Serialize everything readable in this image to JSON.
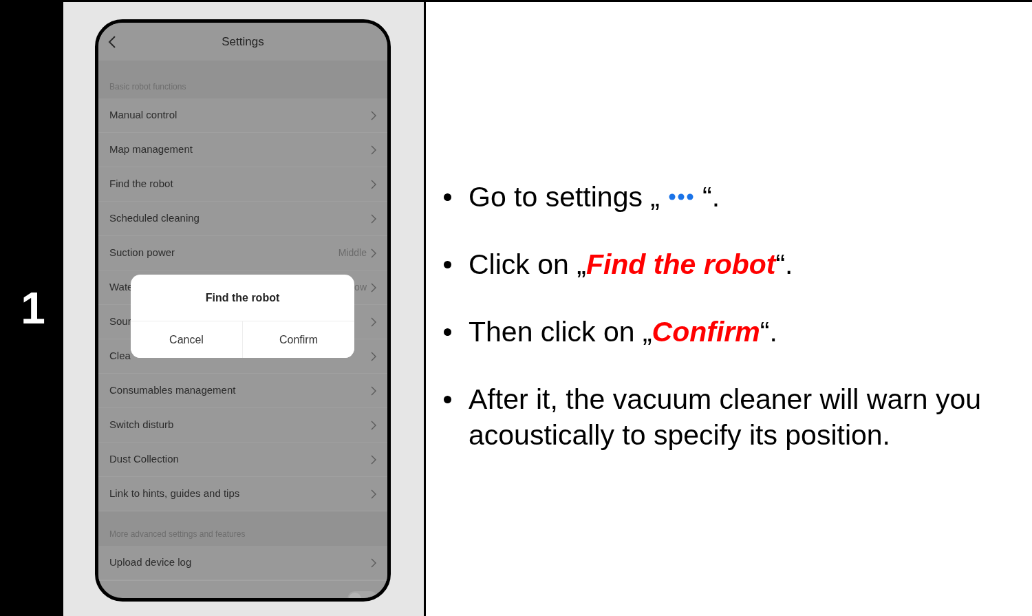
{
  "step": {
    "number": "1"
  },
  "phone": {
    "title": "Settings",
    "sections": [
      {
        "header": "Basic robot functions",
        "rows": [
          {
            "label": "Manual control"
          },
          {
            "label": "Map management"
          },
          {
            "label": "Find the robot"
          },
          {
            "label": "Scheduled cleaning"
          },
          {
            "label": "Suction power",
            "value": "Middle"
          },
          {
            "label": "Wate",
            "value": "ow"
          },
          {
            "label": "Sour"
          },
          {
            "label": "Clea"
          },
          {
            "label": "Consumables management"
          },
          {
            "label": "Switch disturb"
          },
          {
            "label": "Dust Collection"
          },
          {
            "label": "Link to hints, guides and tips"
          }
        ]
      },
      {
        "header": "More advanced settings and features",
        "rows": [
          {
            "label": "Upload device log"
          },
          {
            "kind": "toggle",
            "on": false
          }
        ]
      }
    ],
    "dialog": {
      "title": "Find the robot",
      "buttons": [
        "Cancel",
        "Confirm"
      ]
    }
  },
  "instructions": [
    {
      "parts": [
        {
          "kind": "text",
          "text": "Go to settings „"
        },
        {
          "kind": "dots"
        },
        {
          "kind": "text",
          "text": "“."
        }
      ]
    },
    {
      "parts": [
        {
          "kind": "text",
          "text": "Click on „"
        },
        {
          "kind": "emph",
          "text": "Find the robot"
        },
        {
          "kind": "text",
          "text": "“."
        }
      ]
    },
    {
      "parts": [
        {
          "kind": "text",
          "text": "Then click on „"
        },
        {
          "kind": "emph",
          "text": "Confirm"
        },
        {
          "kind": "text",
          "text": "“."
        }
      ]
    },
    {
      "parts": [
        {
          "kind": "text",
          "text": "After it, the vacuum cleaner will warn you acoustically to specify its position."
        }
      ]
    }
  ]
}
